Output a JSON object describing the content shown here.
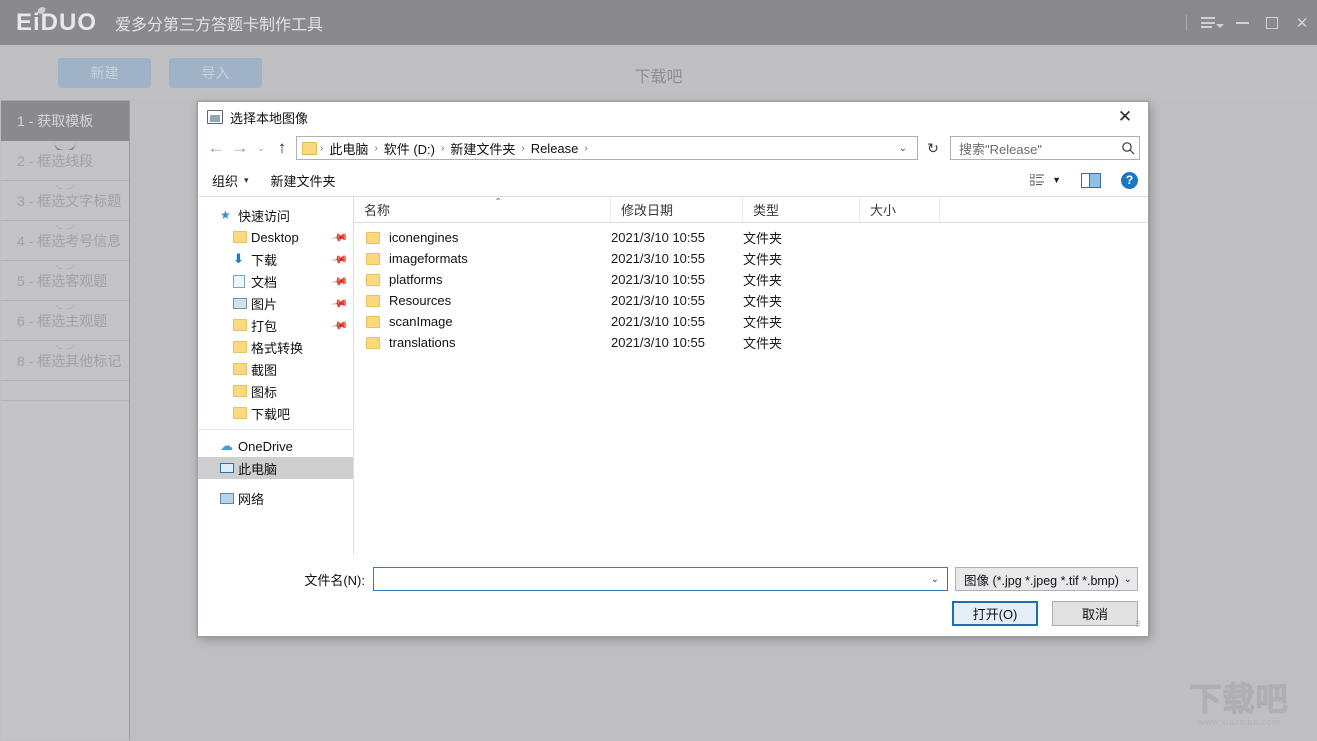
{
  "app": {
    "logo": "EiDUO",
    "title": "爱多分第三方答题卡制作工具",
    "center_title": "下载吧",
    "window_controls": {
      "menu": "menu-icon",
      "minimize": "minimize-icon",
      "maximize": "maximize-icon",
      "close": "close-icon"
    },
    "toolbar": {
      "new_label": "新建",
      "import_label": "导入"
    },
    "sidebar": {
      "items": [
        {
          "label": "1 - 获取模板",
          "active": true
        },
        {
          "label": "2 - 框选线段",
          "active": false
        },
        {
          "label": "3 - 框选文字标题",
          "active": false
        },
        {
          "label": "4 - 框选考号信息",
          "active": false
        },
        {
          "label": "5 - 框选客观题",
          "active": false
        },
        {
          "label": "6 - 框选主观题",
          "active": false
        },
        {
          "label": "8 - 框选其他标记",
          "active": false
        }
      ]
    },
    "watermark": {
      "main": "下载吧",
      "sub": "www.xiazaiba.com"
    }
  },
  "dialog": {
    "title": "选择本地图像",
    "close_label": "✕",
    "nav": {
      "back": "←",
      "forward": "→",
      "history": "⌄",
      "up": "↑",
      "refresh": "↻",
      "breadcrumb": [
        "此电脑",
        "软件 (D:)",
        "新建文件夹",
        "Release"
      ],
      "breadcrumb_sep": "›",
      "dropdown_caret": "⌄"
    },
    "search": {
      "placeholder": "搜索\"Release\"",
      "value": "",
      "icon": "search-icon"
    },
    "commandbar": {
      "organize": "组织",
      "organize_caret": "▾",
      "new_folder": "新建文件夹",
      "view_icon": "view-options-icon",
      "view_caret": "▼",
      "preview_icon": "preview-pane-icon",
      "help_icon": "?"
    },
    "nav_pane": [
      {
        "label": "快速访问",
        "icon": "star-icon",
        "level": "group",
        "pinned": false,
        "selected": false
      },
      {
        "label": "Desktop",
        "icon": "folder-icon",
        "level": "child",
        "pinned": true,
        "selected": false
      },
      {
        "label": "下载",
        "icon": "download-icon",
        "level": "child",
        "pinned": true,
        "selected": false
      },
      {
        "label": "文档",
        "icon": "document-icon",
        "level": "child",
        "pinned": true,
        "selected": false
      },
      {
        "label": "图片",
        "icon": "picture-icon",
        "level": "child",
        "pinned": true,
        "selected": false
      },
      {
        "label": "打包",
        "icon": "folder-icon",
        "level": "child",
        "pinned": true,
        "selected": false
      },
      {
        "label": "格式转换",
        "icon": "folder-icon",
        "level": "child",
        "pinned": false,
        "selected": false
      },
      {
        "label": "截图",
        "icon": "folder-icon",
        "level": "child",
        "pinned": false,
        "selected": false
      },
      {
        "label": "图标",
        "icon": "folder-icon",
        "level": "child",
        "pinned": false,
        "selected": false
      },
      {
        "label": "下载吧",
        "icon": "folder-icon",
        "level": "child",
        "pinned": false,
        "selected": false
      },
      {
        "label": "OneDrive",
        "icon": "cloud-icon",
        "level": "group",
        "pinned": false,
        "selected": false
      },
      {
        "label": "此电脑",
        "icon": "computer-icon",
        "level": "group",
        "pinned": false,
        "selected": true
      },
      {
        "label": "网络",
        "icon": "network-icon",
        "level": "group",
        "pinned": false,
        "selected": false
      }
    ],
    "columns": [
      "名称",
      "修改日期",
      "类型",
      "大小"
    ],
    "sort_indicator": "⌃",
    "files": [
      {
        "name": "iconengines",
        "date": "2021/3/10 10:55",
        "type": "文件夹",
        "size": ""
      },
      {
        "name": "imageformats",
        "date": "2021/3/10 10:55",
        "type": "文件夹",
        "size": ""
      },
      {
        "name": "platforms",
        "date": "2021/3/10 10:55",
        "type": "文件夹",
        "size": ""
      },
      {
        "name": "Resources",
        "date": "2021/3/10 10:55",
        "type": "文件夹",
        "size": ""
      },
      {
        "name": "scanImage",
        "date": "2021/3/10 10:55",
        "type": "文件夹",
        "size": ""
      },
      {
        "name": "translations",
        "date": "2021/3/10 10:55",
        "type": "文件夹",
        "size": ""
      }
    ],
    "footer": {
      "filename_label": "文件名(N):",
      "filename_value": "",
      "filename_caret": "⌄",
      "filter_value": "图像 (*.jpg *.jpeg *.tif *.bmp)",
      "filter_caret": "⌄",
      "open_label": "打开(O)",
      "cancel_label": "取消"
    }
  },
  "colors": {
    "app_titlebar": "#8a8a8d",
    "app_background": "#bfbfc2",
    "accent_button": "#9fb2c6",
    "dialog_accent": "#1a6fb5",
    "folder_yellow": "#fcd97f",
    "help_blue": "#1a78c2"
  }
}
